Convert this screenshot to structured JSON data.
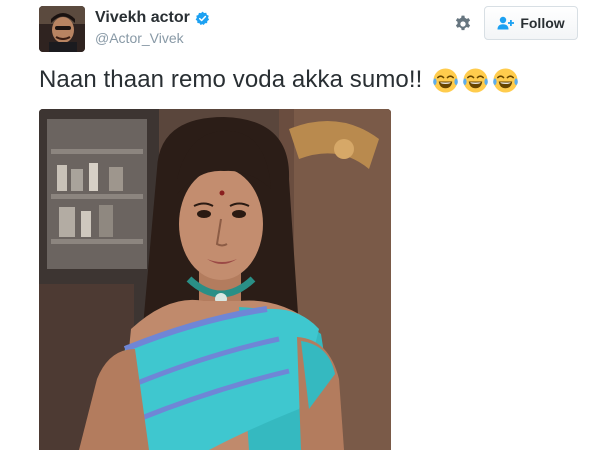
{
  "user": {
    "display_name": "Vivekh actor",
    "handle": "@Actor_Vivek",
    "verified": true,
    "avatar_icon": "profile-photo"
  },
  "actions": {
    "settings_icon": "gear-icon",
    "follow_label": "Follow",
    "follow_icon": "add-user-icon"
  },
  "tweet": {
    "text": "Naan thaan remo voda akka sumo!!",
    "emojis": [
      "face-with-tears-of-joy",
      "face-with-tears-of-joy",
      "face-with-tears-of-joy"
    ]
  },
  "media": {
    "type": "photo",
    "subject": "person-in-wig-and-turquoise-saree"
  },
  "colors": {
    "verified_blue": "#1da1f2",
    "text": "#292f33",
    "secondary_text": "#8899a6",
    "saree_turquoise": "#3fc7cf"
  }
}
